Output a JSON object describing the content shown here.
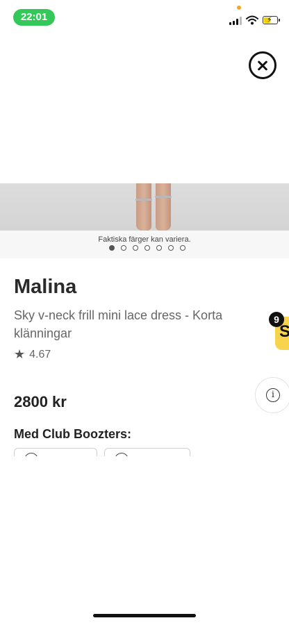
{
  "status": {
    "time": "22:01"
  },
  "image": {
    "caption": "Faktiska färger kan variera.",
    "dot_count": 7,
    "active_index": 0
  },
  "product": {
    "brand": "Malina",
    "name": "Sky v-neck frill mini lace dress - Korta klänningar",
    "rating": "4.67",
    "price": "2800 kr"
  },
  "club": {
    "label": "Med Club Boozters:"
  },
  "badge": {
    "count": "9"
  },
  "icons": {
    "close": "close-icon",
    "star": "star-icon",
    "info": "info-icon",
    "signal": "signal-icon",
    "wifi": "wifi-icon",
    "battery": "battery-charging-icon"
  },
  "colors": {
    "status_pill": "#34c759",
    "badge": "#f8d44c"
  }
}
